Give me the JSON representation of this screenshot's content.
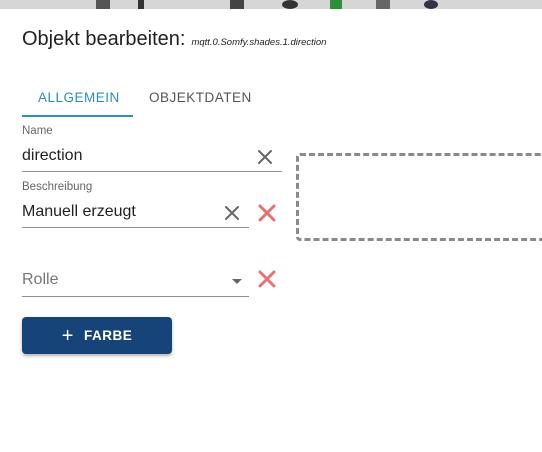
{
  "dialog": {
    "title": "Objekt bearbeiten:",
    "object_id": "mqtt.0.Somfy.shades.1.direction"
  },
  "tabs": [
    {
      "label": "ALLGEMEIN",
      "active": true
    },
    {
      "label": "OBJEKTDATEN",
      "active": false
    }
  ],
  "fields": {
    "name": {
      "label": "Name",
      "value": "direction"
    },
    "description": {
      "label": "Beschreibung",
      "value": "Manuell erzeugt"
    },
    "role": {
      "placeholder": "Rolle",
      "value": ""
    }
  },
  "color_button": {
    "label": "FARBE"
  },
  "colors": {
    "accent": "#2a8fbd",
    "button": "#174478",
    "delete": "#e57373",
    "clear": "#666666"
  },
  "icons": {
    "clear_name": "close-icon",
    "clear_description": "close-icon",
    "delete_description": "delete-x-icon",
    "role_dropdown": "caret-down-icon",
    "delete_role": "delete-x-icon",
    "add": "plus-icon"
  }
}
